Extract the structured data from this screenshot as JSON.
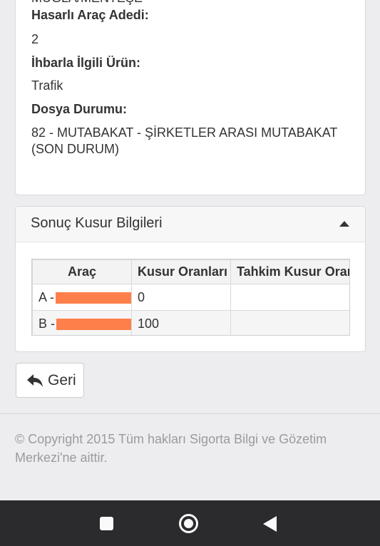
{
  "info_card": {
    "clipped_value": "MUĞLA/MENTEŞE",
    "fields": [
      {
        "label": "Hasarlı Araç Adedi:",
        "value": "2"
      },
      {
        "label": "İhbarla İlgili Ürün:",
        "value": "Trafik"
      },
      {
        "label": "Dosya Durumu:",
        "value": "82 - MUTABAKAT - ŞİRKETLER ARASI MUTABAKAT (SON DURUM)"
      }
    ]
  },
  "result_panel": {
    "title": "Sonuç Kusur Bilgileri",
    "columns": [
      "Araç",
      "Kusur Oranları",
      "Tahkim Kusur Oranı"
    ],
    "rows": [
      {
        "vehicle_prefix": "A -",
        "fault_rate": "0",
        "arbitration_rate": ""
      },
      {
        "vehicle_prefix": "B -",
        "fault_rate": "100",
        "arbitration_rate": ""
      }
    ]
  },
  "back_button": {
    "label": "Geri",
    "icon": "reply-arrow-icon"
  },
  "footer": {
    "copyright": "© Copyright 2015 Tüm hakları Sigorta Bilgi ve Gözetim Merkezi'ne aittir."
  },
  "android_nav": {
    "icons": [
      "recents-icon",
      "home-icon",
      "back-icon"
    ]
  },
  "colors": {
    "redaction": "#ff7f4a",
    "navbar": "#2b2b2e",
    "page_background": "#ededef"
  }
}
